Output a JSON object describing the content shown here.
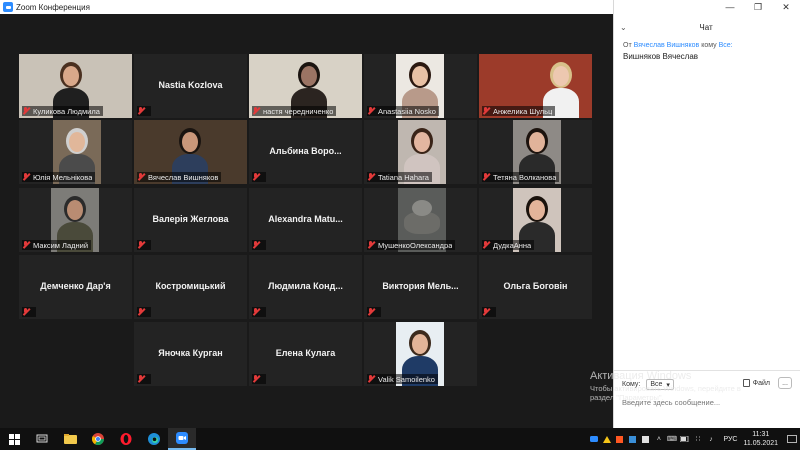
{
  "window": {
    "title": "Zoom Конференция"
  },
  "participants": [
    {
      "name": "Куликова Людмила",
      "video": true
    },
    {
      "name": "Nastia Kozlova",
      "video": false
    },
    {
      "name": "настя чередниченко",
      "video": true
    },
    {
      "name": "Anastasiia Nosko",
      "video": true
    },
    {
      "name": "Анжелика Шульц",
      "video": true
    },
    {
      "name": "Юлія Мельнікова",
      "video": true
    },
    {
      "name": "Вячеслав Вишняков",
      "video": true,
      "active_speaker": true
    },
    {
      "name": "Альбина Воронова",
      "center_name": "Альбина Воро...",
      "video": false
    },
    {
      "name": "Tatiana Hahara",
      "video": true
    },
    {
      "name": "Тетяна Волканова",
      "video": true
    },
    {
      "name": "Максим Ладний",
      "video": true
    },
    {
      "name": "Валерія Жеглова",
      "video": false
    },
    {
      "name": "Alexandra Matushenko",
      "center_name": "Alexandra Matu...",
      "video": false
    },
    {
      "name": "МушенкоОлександра",
      "video": true
    },
    {
      "name": "ДудкаАнна",
      "video": true
    },
    {
      "name": "Демченко Дар'я",
      "video": false
    },
    {
      "name": "Костромицький",
      "video": false
    },
    {
      "name": "Людмила Кондратенко",
      "center_name": "Людмила Конд...",
      "video": false
    },
    {
      "name": "Виктория Мельник",
      "center_name": "Виктория Мель...",
      "video": false
    },
    {
      "name": "Ольга Боговін",
      "video": false
    },
    {
      "name": "Яночка Курган",
      "video": false
    },
    {
      "name": "Елена Кулага",
      "video": false
    },
    {
      "name": "Valik Samoilenko",
      "video": true
    }
  ],
  "chat": {
    "title": "Чат",
    "messages": [
      {
        "from_prefix": "От",
        "from": "Вячеслав Вишняков",
        "to_prefix": "кому",
        "to": "Все:",
        "text": "Вишняков Вячеслав"
      }
    ],
    "to_label": "Кому:",
    "to_value": "Все",
    "file_label": "Файл",
    "more_label": "...",
    "input_placeholder": "Введите здесь сообщение..."
  },
  "watermark": {
    "title": "Активация Windows",
    "line1": "Чтобы активировать Windows, перейдите в",
    "line2": "раздел \"Параметры\"."
  },
  "taskbar": {
    "lang": "РУС",
    "time": "11:31",
    "date": "11.05.2021"
  },
  "colors": {
    "zoom_blue": "#2d8cff",
    "active_speaker_border": "#c8d94c",
    "muted_icon": "#e23a3a",
    "tile_bg": "#232323",
    "gallery_bg": "#1a1a1a"
  }
}
